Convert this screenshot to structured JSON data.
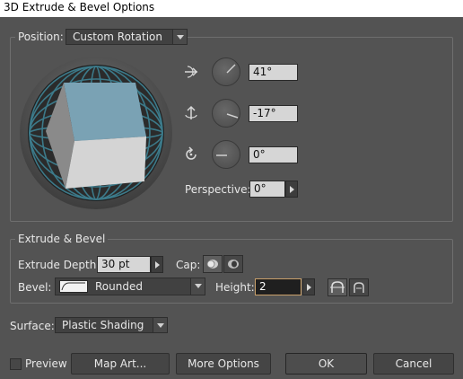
{
  "window": {
    "title": "3D Extrude & Bevel Options"
  },
  "position": {
    "label": "Position:",
    "preset": "Custom Rotation",
    "x_rotation": "41°",
    "y_rotation": "-17°",
    "z_rotation": "0°",
    "perspective_label": "Perspective:",
    "perspective_value": "0°"
  },
  "extrude": {
    "group_label": "Extrude & Bevel",
    "depth_label": "Extrude Depth:",
    "depth_value": "30 pt",
    "cap_label": "Cap:",
    "bevel_label": "Bevel:",
    "bevel_value": "Rounded",
    "height_label": "Height:",
    "height_value": "2"
  },
  "surface": {
    "label": "Surface:",
    "value": "Plastic Shading"
  },
  "footer": {
    "preview_label": "Preview",
    "preview_checked": false,
    "map_art": "Map Art...",
    "more_options": "More Options",
    "ok": "OK",
    "cancel": "Cancel"
  },
  "colors": {
    "panel": "#535353",
    "cube_top": "#7aa2b4",
    "cube_left": "#8a8a8a",
    "cube_right": "#d4d4d4",
    "sphere_grid": "#3c7a8a"
  },
  "icons": {
    "x_axis": "rotate-x-axis-icon",
    "y_axis": "rotate-y-axis-icon",
    "z_axis": "rotate-z-axis-icon",
    "cap_on": "cap-on-icon",
    "cap_off": "cap-off-icon",
    "bevel_out": "bevel-extent-out-icon",
    "bevel_in": "bevel-extent-in-icon"
  }
}
